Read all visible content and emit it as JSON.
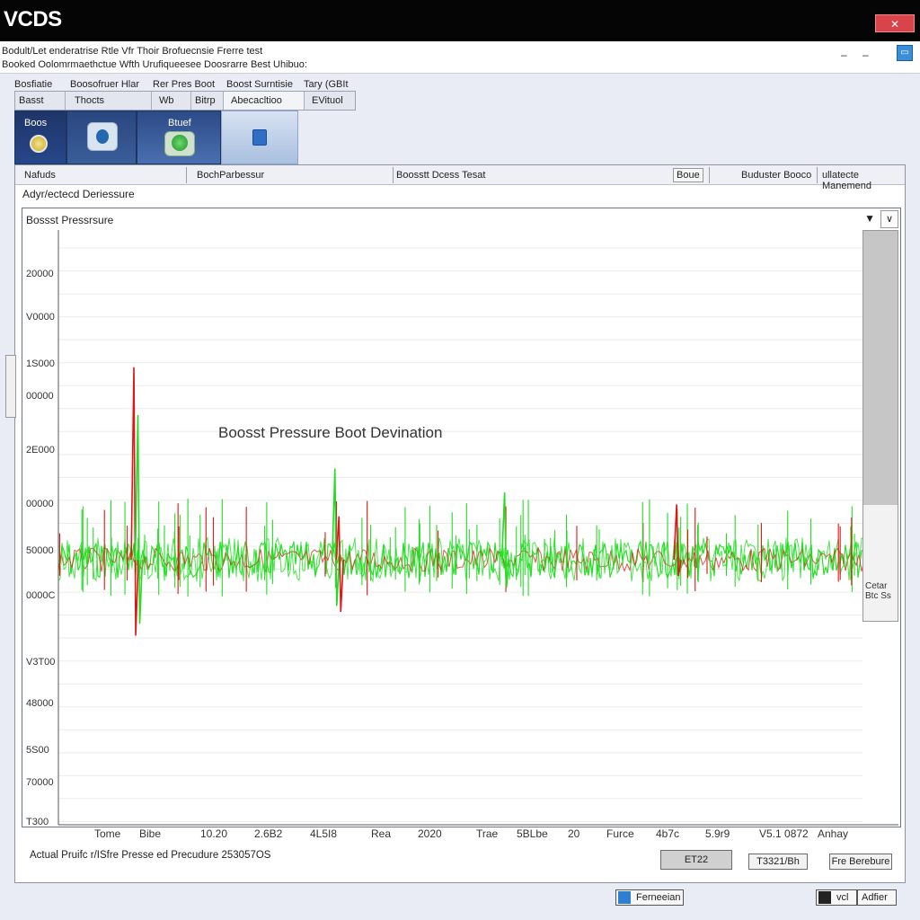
{
  "app": {
    "title": "VCDS",
    "close_label": "✕",
    "subtitle_line1": "Bodult/Let enderatrise Rtle Vfr Thoir Brofuecnsie Frerre test",
    "subtitle_line2": "Booked Oolomrmaethctue Wfth Urufiqueesee Doosrarre Best Uhibuo:",
    "minimize_label": "–",
    "restore_label": "–",
    "app_icon_label": "▭"
  },
  "menu": {
    "items": [
      "Bosfiatie",
      "Boosofruer Hlar",
      "Rer Pres Boot"
    ]
  },
  "tabs": [
    {
      "label": "Basst",
      "active": false
    },
    {
      "label": "Thocts",
      "active": false
    },
    {
      "label": "Wb",
      "active": false
    },
    {
      "label": "Bitrp",
      "active": false
    },
    {
      "label": "Abecacltioo",
      "active": true
    },
    {
      "label": "EVituol",
      "active": false
    }
  ],
  "extra_menu": [
    "Boost Surntisie",
    "Tary (GBIt"
  ],
  "tiles": [
    {
      "label": "Boos"
    },
    {
      "label": ""
    },
    {
      "label": "Btuef"
    },
    {
      "label": ""
    }
  ],
  "columns": {
    "c1": "Nafuds",
    "c2": "BochParbessur",
    "c3": "Boosstt Dcess Tesat",
    "c4": "Boue",
    "c5": "Buduster Booco",
    "c6": "ullatecte Manemend"
  },
  "detail_label": "Adyr/ectecd Deriessure",
  "chart_panel": {
    "header": "Bossst Pressrsure",
    "dropdown_arrow": "▼",
    "dropdown_glyph": "∨",
    "scroll_label_1": "Cetar",
    "scroll_label_2": "Btc Ss"
  },
  "chart_data": {
    "type": "line",
    "title": "Boosst Pressure  Boot Devination",
    "yticks": [
      "20000",
      "V0000",
      "1S000",
      "00000",
      "2E000",
      "00000",
      "50000",
      "0000C",
      "V3T00",
      "48000",
      "5S00",
      "70000",
      "T300"
    ],
    "xticks": [
      "Tome",
      "Bibe",
      "10.20",
      "2.6B2",
      "4L5I8",
      "Rea",
      "2020",
      "Trae",
      "5BLbe",
      "20",
      "Furce",
      "4b7c",
      "5.9r9",
      "V5.1 0872",
      "Anhay"
    ],
    "series": [
      {
        "color": "#22dd22"
      },
      {
        "color": "#e01515"
      }
    ],
    "baseline_fraction": 0.553,
    "band_fraction": 0.022,
    "spikes": [
      {
        "x_frac": 0.095,
        "y_top_frac": 0.23,
        "y_bot_frac": 0.68,
        "color": "#e01515"
      },
      {
        "x_frac": 0.1,
        "y_top_frac": 0.31,
        "y_bot_frac": 0.66,
        "color": "#22dd22"
      },
      {
        "x_frac": 0.345,
        "y_top_frac": 0.4,
        "y_bot_frac": 0.63,
        "color": "#22dd22"
      },
      {
        "x_frac": 0.35,
        "y_top_frac": 0.48,
        "y_bot_frac": 0.64,
        "color": "#e01515"
      },
      {
        "x_frac": 0.556,
        "y_top_frac": 0.44,
        "y_bot_frac": 0.6,
        "color": "#22dd22"
      },
      {
        "x_frac": 0.77,
        "y_top_frac": 0.46,
        "y_bot_frac": 0.58,
        "color": "#e01515"
      }
    ]
  },
  "footer": {
    "status_text": "Actual Pruifc r/ISfre Presse ed Precudure 253057OS",
    "btn1": "ET22",
    "btn2": "T3321/Bh",
    "btn3": "Fre Berebure"
  },
  "taskbar": {
    "btn1": "Ferneeian",
    "btn2": "vcl",
    "btn3": "Adfier"
  }
}
